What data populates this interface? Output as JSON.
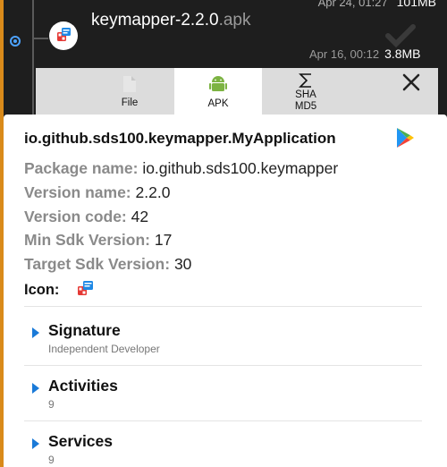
{
  "file_list": {
    "top_row": {
      "date": "Apr 24, 01:27",
      "size": "101MB"
    },
    "current": {
      "name": "keymapper-2.2.0",
      "ext": ".apk",
      "date": "Apr 16, 00:12",
      "size": "3.8MB"
    }
  },
  "tabs": [
    {
      "label": "File",
      "icon": "file-icon"
    },
    {
      "label": "APK",
      "icon": "android-icon"
    },
    {
      "label": "SHA",
      "label2": "MD5",
      "icon": "sigma-icon"
    }
  ],
  "close_icon": "close-icon",
  "app": {
    "name": "io.github.sds100.keymapper.MyApplication",
    "fields": [
      {
        "key": "Package name:",
        "value": "io.github.sds100.keymapper"
      },
      {
        "key": "Version name:",
        "value": "2.2.0"
      },
      {
        "key": "Version code:",
        "value": "42"
      },
      {
        "key": "Min Sdk Version:",
        "value": "17"
      },
      {
        "key": "Target Sdk Version:",
        "value": "30"
      }
    ],
    "icon_label": "Icon:"
  },
  "sections": [
    {
      "title": "Signature",
      "subtitle": "Independent Developer"
    },
    {
      "title": "Activities",
      "subtitle": "9"
    },
    {
      "title": "Services",
      "subtitle": "9"
    }
  ],
  "colors": {
    "accent": "#1a7ad8",
    "rail": "#d98a1a",
    "radio": "#4da3ff"
  }
}
